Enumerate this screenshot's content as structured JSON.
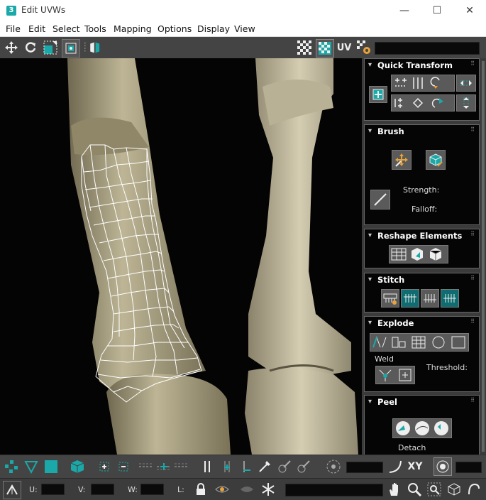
{
  "window": {
    "title": "Edit UVWs",
    "app_badge": "3",
    "controls": [
      "—",
      "☐",
      "✕"
    ]
  },
  "menu": [
    "File",
    "Edit",
    "Select",
    "Tools",
    "Mapping",
    "Options",
    "Display",
    "View"
  ],
  "toolbar_top": {
    "uv_label": "UV"
  },
  "panel": {
    "quick_transform": {
      "title": "Quick Transform"
    },
    "brush": {
      "title": "Brush",
      "strength_label": "Strength:",
      "falloff_label": "Falloff:"
    },
    "reshape": {
      "title": "Reshape Elements"
    },
    "stitch": {
      "title": "Stitch"
    },
    "explode": {
      "title": "Explode",
      "weld_label": "Weld",
      "threshold_label": "Threshold:"
    },
    "peel": {
      "title": "Peel",
      "detach_label": "Detach"
    }
  },
  "bottom": {
    "xy_label": "XY",
    "u_label": "U:",
    "v_label": "V:",
    "w_label": "W:",
    "l_label": "L:"
  },
  "colors": {
    "accent": "#1aa8a8",
    "selected_button": "#0f6c70"
  },
  "icons": [
    "move-icon",
    "rotate-icon",
    "scale-icon",
    "freeform-icon",
    "mirror-icon",
    "checker-icon",
    "map-icon",
    "gear-icon",
    "hand-icon",
    "zoom-icon",
    "snowflake-icon",
    "lock-icon",
    "eye-icon"
  ]
}
